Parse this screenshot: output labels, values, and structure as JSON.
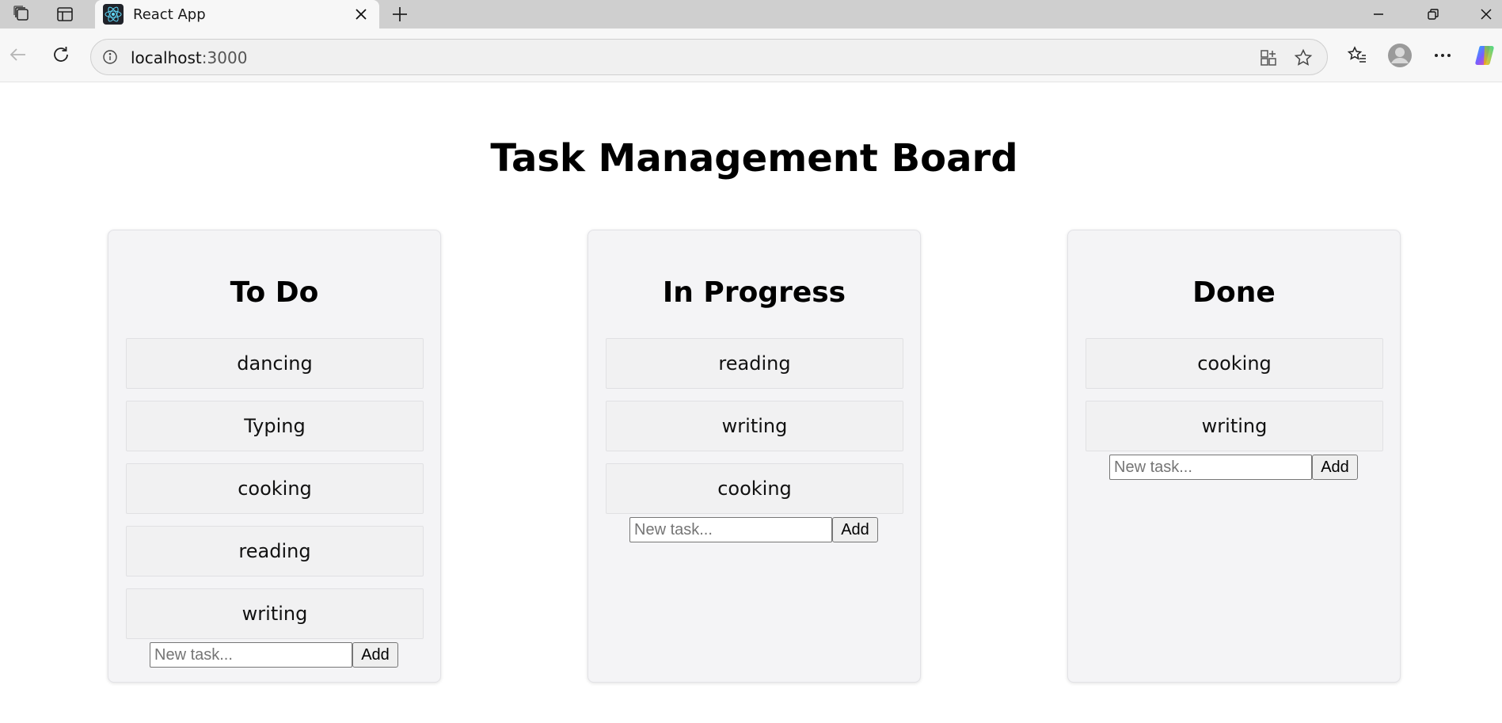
{
  "browser": {
    "tab_title": "React App",
    "url_host": "localhost",
    "url_port": ":3000"
  },
  "page": {
    "title": "Task Management Board"
  },
  "columns": [
    {
      "title": "To Do",
      "tasks": [
        "dancing",
        "Typing",
        "cooking",
        "reading",
        "writing"
      ],
      "input_placeholder": "New task...",
      "add_label": "Add"
    },
    {
      "title": "In Progress",
      "tasks": [
        "reading",
        "writing",
        "cooking"
      ],
      "input_placeholder": "New task...",
      "add_label": "Add"
    },
    {
      "title": "Done",
      "tasks": [
        "cooking",
        "writing"
      ],
      "input_placeholder": "New task...",
      "add_label": "Add"
    }
  ]
}
